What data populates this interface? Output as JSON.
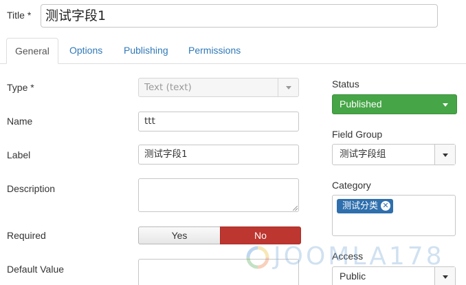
{
  "title": {
    "label": "Title *",
    "value": "测试字段1"
  },
  "tabs": [
    {
      "label": "General",
      "active": true
    },
    {
      "label": "Options"
    },
    {
      "label": "Publishing"
    },
    {
      "label": "Permissions"
    }
  ],
  "fields": {
    "type": {
      "label": "Type *",
      "value": "Text (text)"
    },
    "name": {
      "label": "Name",
      "value": "ttt"
    },
    "label_field": {
      "label": "Label",
      "value": "测试字段1"
    },
    "description": {
      "label": "Description",
      "value": ""
    },
    "required": {
      "label": "Required",
      "yes": "Yes",
      "no": "No",
      "selected": "No"
    },
    "default_value": {
      "label": "Default Value",
      "value": ""
    }
  },
  "sidebar": {
    "status": {
      "label": "Status",
      "value": "Published"
    },
    "field_group": {
      "label": "Field Group",
      "value": "测试字段组"
    },
    "category": {
      "label": "Category",
      "chips": [
        "测试分类"
      ]
    },
    "access": {
      "label": "Access",
      "value": "Public"
    }
  },
  "watermark": {
    "text": "JOOMLA178"
  },
  "colors": {
    "link": "#2f78b7",
    "status_green": "#46a546",
    "no_red": "#bd362f",
    "chip_blue": "#2f6fad"
  }
}
